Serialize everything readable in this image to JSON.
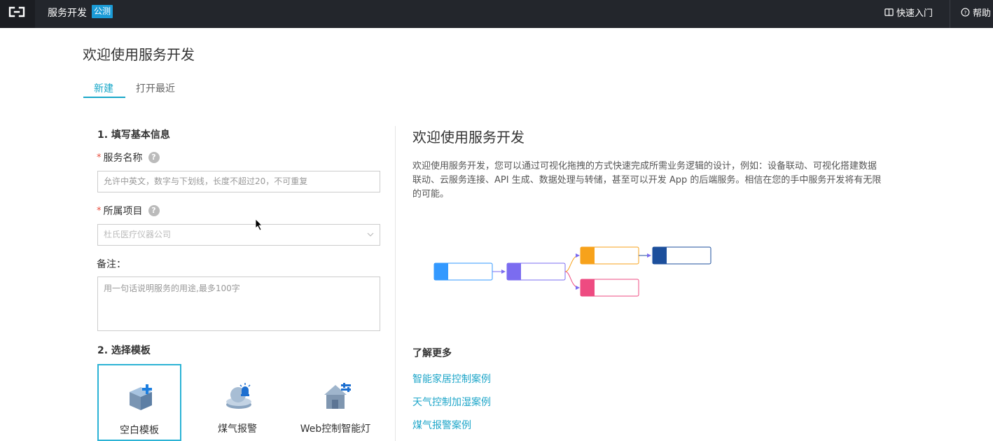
{
  "header": {
    "brand": "服务开发",
    "badge": "公测",
    "quickstart": "快速入门",
    "help": "帮助"
  },
  "page": {
    "title": "欢迎使用服务开发",
    "tabs": [
      {
        "label": "新建",
        "active": true
      },
      {
        "label": "打开最近",
        "active": false
      }
    ]
  },
  "form": {
    "section1": "1. 填写基本信息",
    "service_name_label": "服务名称",
    "service_name_placeholder": "允许中英文，数字与下划线，长度不超过20，不可重复",
    "project_label": "所属项目",
    "project_value": "杜氏医疗仪器公司",
    "note_label": "备注：",
    "note_placeholder": "用一句话说明服务的用途,最多100字",
    "section2": "2. 选择模板",
    "templates": [
      {
        "label": "空白模板",
        "selected": true
      },
      {
        "label": "煤气报警",
        "selected": false
      },
      {
        "label": "Web控制智能灯",
        "selected": false
      }
    ]
  },
  "intro": {
    "title": "欢迎使用服务开发",
    "description": "欢迎使用服务开发，您可以通过可视化拖拽的方式快速完成所需业务逻辑的设计，例如：设备联动、可视化搭建数据联动、云服务连接、API 生成、数据处理与转储，甚至可以开发 App 的后端服务。相信在您的手中服务开发将有无限的可能。",
    "learn_more": "了解更多",
    "links": [
      "智能家居控制案例",
      "天气控制加湿案例",
      "煤气报警案例"
    ]
  },
  "colors": {
    "accent": "#18a7c8",
    "header_bg": "#23262c",
    "badge_bg": "#1b9bd6",
    "node_blue": "#3399ff",
    "node_purple": "#7b6cf0",
    "node_orange": "#f7a21b",
    "node_navy": "#1c4f9c",
    "node_pink": "#ee4b81"
  }
}
